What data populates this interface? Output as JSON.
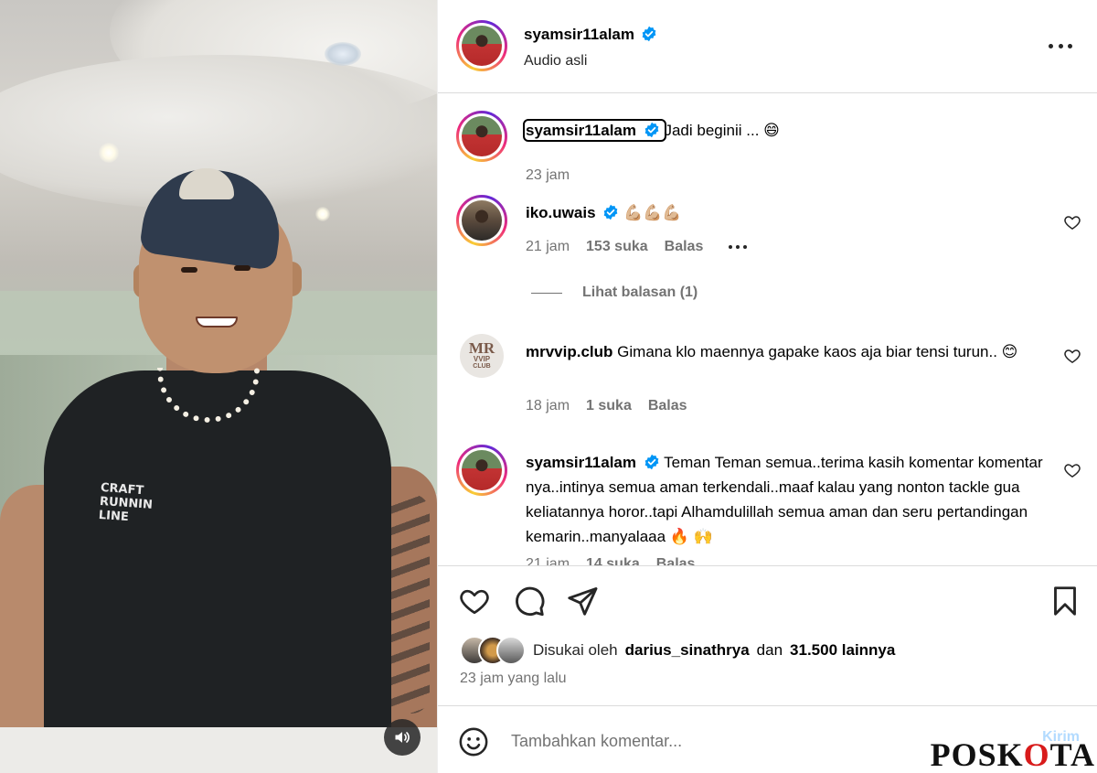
{
  "header": {
    "username": "syamsir11alam",
    "subtitle": "Audio asli"
  },
  "caption": {
    "username": "syamsir11alam",
    "text": "Jadi beginii ... 😄",
    "time": "23 jam"
  },
  "comments": [
    {
      "username": "iko.uwais",
      "text": "💪🏼💪🏼💪🏼",
      "time": "21 jam",
      "likes": "153 suka",
      "reply_label": "Balas",
      "view_replies": "Lihat balasan (1)"
    },
    {
      "username": "mrvvip.club",
      "text": "Gimana klo maennya gapake kaos aja biar tensi turun.. 😊",
      "time": "18 jam",
      "likes": "1 suka",
      "reply_label": "Balas",
      "avatar_text_top": "MR",
      "avatar_text_mid": "VVIP",
      "avatar_text_bot": "CLUB"
    },
    {
      "username": "syamsir11alam",
      "text": "Teman Teman semua..terima kasih komentar komentar nya..intinya semua aman terkendali..maaf kalau yang nonton tackle gua keliatannya horor..tapi Alhamdulillah semua aman dan seru pertandingan kemarin..manyalaaa 🔥 🙌",
      "time": "21 jam",
      "likes": "14 suka",
      "reply_label": "Balas"
    }
  ],
  "video": {
    "shirt_print": "CRAFT RUNNIN LINE"
  },
  "likes_line": {
    "prefix": "Disukai oleh",
    "user": "darius_sinathrya",
    "middle": "dan",
    "count": "31.500 lainnya"
  },
  "time_ago": "23 jam yang lalu",
  "add_comment": {
    "placeholder": "Tambahkan komentar...",
    "post_label": "Kirim"
  },
  "watermark": {
    "pre": "POSK",
    "o": "O",
    "post": "TA"
  },
  "colors": {
    "verified": "#0095f6",
    "muted": "#737373",
    "border": "#dbdbdb",
    "post_disabled": "#b3dbff"
  },
  "icons": {
    "verified": "verified-badge-icon",
    "like": "heart-icon",
    "comment": "comment-bubble-icon",
    "share": "paper-plane-icon",
    "save": "bookmark-icon",
    "emoji": "smiley-icon",
    "more": "more-options-icon",
    "sound": "speaker-icon"
  }
}
